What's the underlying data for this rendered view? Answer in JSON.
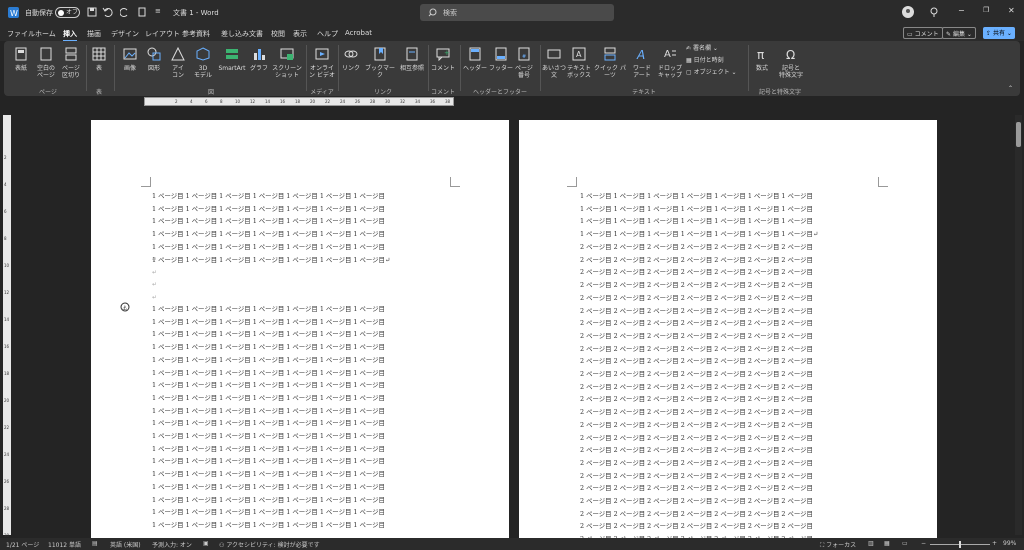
{
  "titlebar": {
    "autosave_label": "自動保存",
    "autosave_state": "オフ",
    "doc_title": "文書 1  -  Word",
    "search_placeholder": "検索"
  },
  "tabs": [
    "ファイル",
    "ホーム",
    "挿入",
    "描画",
    "デザイン",
    "レイアウト",
    "参考資料",
    "差し込み文書",
    "校閲",
    "表示",
    "ヘルプ",
    "Acrobat"
  ],
  "active_tab": "挿入",
  "top_right": {
    "comment": "コメント",
    "edit": "編集",
    "share": "共有"
  },
  "ribbon": {
    "page_buttons": [
      "表紙",
      "空白の\nページ",
      "ページ\n区切り"
    ],
    "page_group": "ページ",
    "table_button": "表",
    "table_group": "表",
    "illus_buttons": [
      "画像",
      "図形",
      "アイ\nコン",
      "3D\nモデル",
      "SmartArt",
      "グラフ",
      "スクリーン\nショット"
    ],
    "illus_group": "図",
    "media_button": "オンライ\nン ビデオ",
    "media_group": "メディア",
    "link_buttons": [
      "リンク",
      "ブックマーク",
      "相互参照"
    ],
    "link_group": "リンク",
    "comment_button": "コメント",
    "comment_group": "コメント",
    "hf_buttons": [
      "ヘッダー",
      "フッター",
      "ページ\n番号"
    ],
    "hf_group": "ヘッダーとフッター",
    "text_buttons": [
      "あいさつ\n文",
      "テキスト\nボックス",
      "クイック パーツ",
      "ワード\nアート",
      "ドロップ\nキャップ"
    ],
    "text_small": [
      "署名欄",
      "日付と時刻",
      "オブジェクト"
    ],
    "text_group": "テキスト",
    "sym_buttons": [
      "数式",
      "記号と\n特殊文字"
    ],
    "sym_group": "記号と特殊文字"
  },
  "ruler_ticks": [
    "2",
    "4",
    "6",
    "8",
    "10",
    "12",
    "14",
    "16",
    "18",
    "20",
    "22",
    "24",
    "26",
    "28",
    "30",
    "32",
    "34",
    "36",
    "38"
  ],
  "vruler_ticks": [
    "2",
    "4",
    "6",
    "8",
    "10",
    "12",
    "14",
    "16",
    "18",
    "20",
    "22",
    "24",
    "26",
    "28",
    "30"
  ],
  "page1": {
    "line_text": "1 ページ目 1 ページ目 1 ページ目 1 ページ目 1 ページ目 1 ページ目 1 ページ目",
    "last_line_text": "1 ページ目 1 ページ目 1 ページ目 1 ページ目 1 ページ目 1 ページ目 1 ページ目↵",
    "para_mark": "↵"
  },
  "page2": {
    "line1_text": "1 ページ目 1 ページ目 1 ページ目 1 ページ目 1 ページ目 1 ページ目 1 ページ目",
    "line1_end": "1 ページ目 1 ページ目 1 ページ目 1 ページ目 1 ページ目 1 ページ目 1 ページ目↵",
    "line2_text": "2 ページ目 2 ページ目 2 ページ目 2 ページ目 2 ページ目 2 ページ目 2 ページ目"
  },
  "status": {
    "page": "1/21 ページ",
    "words": "11012 単語",
    "lang": "英語 (米国)",
    "predict": "予測入力: オン",
    "access": "アクセシビリティ: 検討が必要です",
    "focus": "フォーカス",
    "zoom": "99%"
  }
}
